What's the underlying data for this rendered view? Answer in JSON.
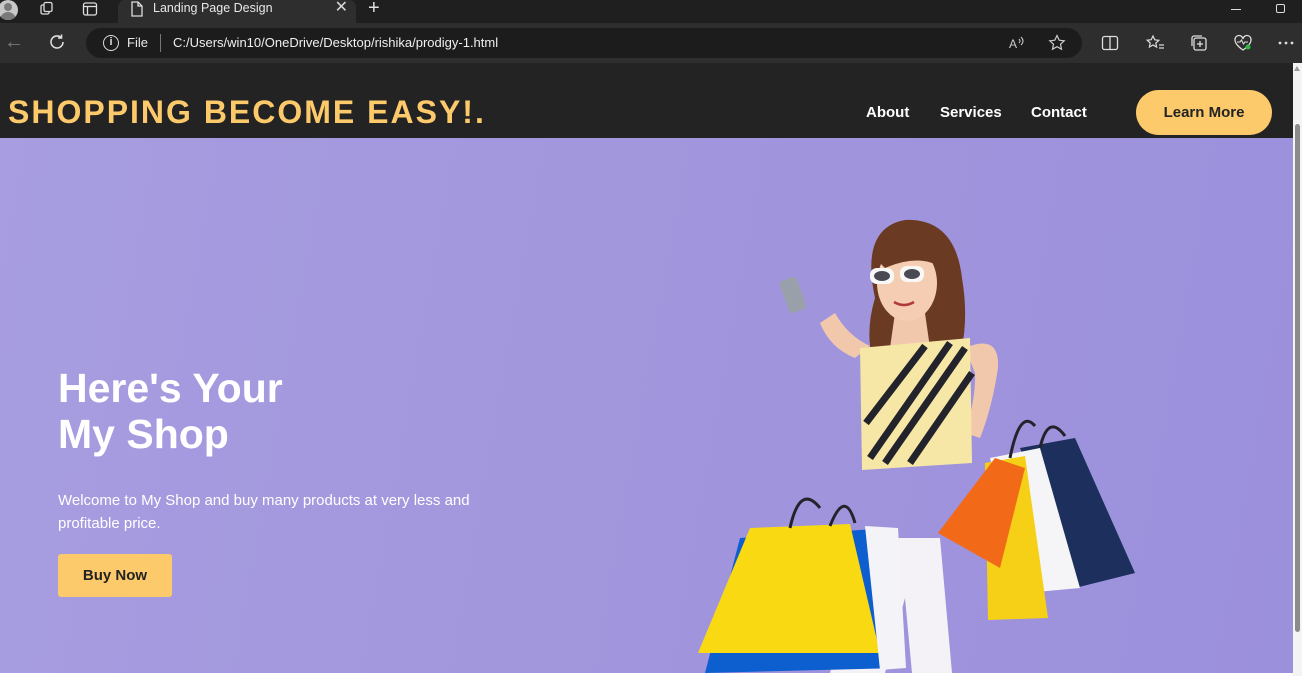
{
  "browser": {
    "tab_title": "Landing Page Design",
    "tab_close": "✕",
    "new_tab": "+",
    "back": "←",
    "file_label": "File",
    "info_glyph": "i",
    "url": "C:/Users/win10/OneDrive/Desktop/rishika/prodigy-1.html"
  },
  "site": {
    "logo": "SHOPPING BECOME EASY!.",
    "menu": [
      "About",
      "Services",
      "Contact"
    ],
    "cta": "Learn More",
    "accent_color": "#fcca6b",
    "nav_background": "#232323"
  },
  "hero": {
    "title_line1": "Here's Your",
    "title_line2": "My Shop",
    "text": "Welcome to My Shop and buy many products at very less and profitable price.",
    "button": "Buy Now",
    "background_color": "#a29ade"
  }
}
